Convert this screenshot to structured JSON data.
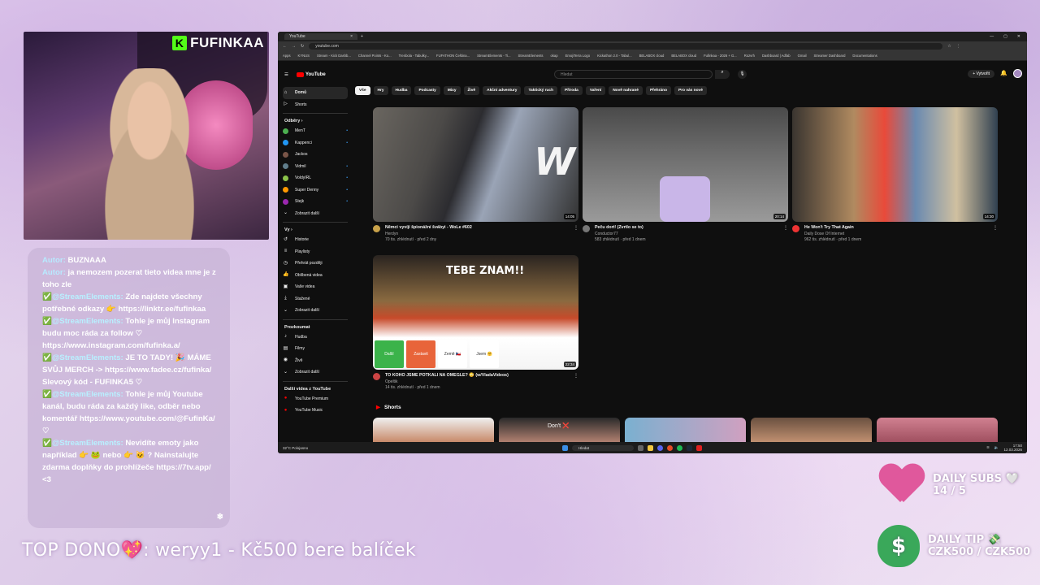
{
  "stream": {
    "webcam_badge": "FUFINKAA",
    "chat": [
      {
        "author": "Autor:",
        "name": "BUZNAAA",
        "text": ""
      },
      {
        "author": "Autor:",
        "name": "",
        "text": "ja nemozem pozerat tieto videa mne je z toho zle"
      },
      {
        "author": "",
        "name": "✅@StreamElements:",
        "text": "Zde najdete všechny potřebné odkazy 👉 https://linktr.ee/fufinkaa"
      },
      {
        "author": "",
        "name": "✅@StreamElements:",
        "text": "Tohle je můj Instagram budu moc ráda za follow ♡ https://www.instagram.com/fufinka.a/"
      },
      {
        "author": "",
        "name": "✅@StreamElements:",
        "text": "JE TO TADY! 🎉 MÁME SVŮJ MERCH -> https://www.fadee.cz/fufinka/ Slevový kód - FUFINKA5 ♡"
      },
      {
        "author": "",
        "name": "✅@StreamElements:",
        "text": "Tohle je můj Youtube kanál, budu ráda za každý like, odběr nebo komentář https://www.youtube.com/@FufinKa/ ♡"
      },
      {
        "author": "",
        "name": "✅@StreamElements:",
        "text": "Nevidíte emoty jako například 👉 🐸 nebo 👉 🐱 ? Nainstalujte zdarma doplňky do prohlížeče https://7tv.app/ <3"
      }
    ],
    "top_dono": "TOP DONO💖: weryy1 - Kč500 bere balíček",
    "daily_subs_label": "DAILY SUBS 🤍",
    "daily_subs_value": "14 / 5",
    "daily_tip_label": "DAILY TIP 💸",
    "daily_tip_value": "CZK500 / CZK500"
  },
  "browser": {
    "tab_title": "YouTube",
    "url": "youtube.com",
    "bookmarks": [
      "Apps",
      "KYNUS",
      "Stream - Kick Dashb...",
      "Channel Points - Ko...",
      "Trenbola - Tabulky...",
      "FUFATHON Čeština...",
      "StreamElements - Ti...",
      "StreamElements",
      "okap",
      "EmojiTerra Logo",
      "Kickathon 2.0 - Tabul...",
      "BELABOX cloud",
      "BELABOX cloud",
      "Fufinkaa - 2026 + G...",
      "Rozvrh",
      "Dashboard | Adfab",
      "Gmail",
      "Streamer Dashboard",
      "Documentations"
    ]
  },
  "youtube": {
    "logo": "YouTube",
    "search_placeholder": "Hledat",
    "create_label": "+ Vytvořit",
    "sidebar": {
      "main": [
        {
          "label": "Domů",
          "active": true,
          "icon": "home-icon"
        },
        {
          "label": "Shorts",
          "active": false,
          "icon": "shorts-icon"
        }
      ],
      "subs_header": "Odběry ›",
      "subs": [
        {
          "label": "MenT",
          "color": "#4caf50",
          "dot": true
        },
        {
          "label": "Kappenci",
          "color": "#2196f3",
          "dot": true
        },
        {
          "label": "Jackos",
          "color": "#795548",
          "dot": false
        },
        {
          "label": "Vidmil",
          "color": "#607d8b",
          "dot": true
        },
        {
          "label": "VoldyIRL",
          "color": "#8bc34a",
          "dot": true
        },
        {
          "label": "Super Denny",
          "color": "#ff9800",
          "dot": true
        },
        {
          "label": "Stejk",
          "color": "#9c27b0",
          "dot": true
        },
        {
          "label": "Zobrazit další",
          "color": "",
          "dot": false
        }
      ],
      "you_header": "Vy ›",
      "you": [
        "Historie",
        "Playlisty",
        "Přehrát později",
        "Oblíbená videa",
        "Vaše videa",
        "Stažené",
        "Zobrazit další"
      ],
      "explore_header": "Prozkoumat",
      "explore": [
        "Hudba",
        "Filmy",
        "Živě",
        "Zobrazit další"
      ],
      "more_header": "Další videa z YouTube",
      "more": [
        "YouTube Premium",
        "YouTube Music"
      ]
    },
    "chips": [
      "Vše",
      "Hry",
      "Hudba",
      "Podcasty",
      "Mixy",
      "Živě",
      "Akční adventury",
      "Taktický ruch",
      "Příroda",
      "Vaření",
      "Nově nahrané",
      "Přehráno",
      "Pro vás nové"
    ],
    "videos": [
      {
        "title": "Němci vyvíjí špionážní švábyi - WoLe #602",
        "channel": "Herdyn",
        "stats": "70 tis. zhlédnutí · před 2 dny",
        "duration": "14:05"
      },
      {
        "title": "Peču dort! (Zvrtlo se to)",
        "channel": "Conductor77",
        "stats": "583 zhlédnutí · před 1 dnem",
        "duration": "20:14"
      },
      {
        "title": "He Won't Try That Again",
        "channel": "Daily Dose Of Internet",
        "stats": "962 tis. zhlédnutí · před 1 dnem",
        "duration": "14:30"
      },
      {
        "title": "TO KOHO JSME POTKALI NA OMEGLE? 😳 (w/VladaVideos)",
        "channel": "Opeltik",
        "stats": "14 tis. zhlédnutí · před 1 dnem",
        "duration": "22:34"
      }
    ],
    "thumb_text": {
      "w": "W",
      "tebe": "TEBE ZNAM!!",
      "dont": "Don't ❌"
    },
    "omegle_buttons": [
      "Další",
      "Zastavit",
      "Země 🇨🇿",
      "Jsem 🤗"
    ],
    "shorts_label": "Shorts"
  },
  "taskbar": {
    "weather": "32°C Polojasno",
    "search": "Hledat",
    "clock": "17:50",
    "date": "12.03.2026"
  }
}
